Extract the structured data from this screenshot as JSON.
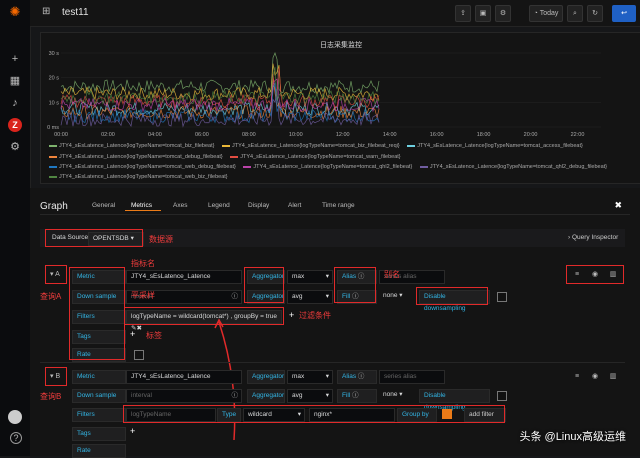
{
  "dashboard": {
    "title": "test11"
  },
  "topbar": {
    "today_label": "Today"
  },
  "graph": {
    "title": "日志采集监控",
    "y_ticks": [
      "30 s",
      "20 s",
      "10 s",
      "0 ms"
    ],
    "x_ticks": [
      "00:00",
      "02:00",
      "04:00",
      "06:00",
      "08:00",
      "10:00",
      "12:00",
      "14:00",
      "16:00",
      "18:00",
      "20:00",
      "22:00"
    ],
    "legend": [
      "JTY4_sEsLatence_Latence{logTypeName=tomcat_biz_filebeat}",
      "JTY4_sEsLatence_Latence{logTypeName=tomcat_biz_filebeat_reqi}",
      "JTY4_sEsLatence_Latence{logTypeName=tomcat_access_filebeat}",
      "JTY4_sEsLatence_Latence{logTypeName=tomcat_debug_filebeat}",
      "JTY4_sEsLatence_Latence{logTypeName=tomcat_warn_filebeat}",
      "JTY4_sEsLatence_Latence{logTypeName=tomcat_web_debug_filebeat}",
      "JTY4_sEsLatence_Latence{logTypeName=tomcat_qhl2_filebeat}",
      "JTY4_sEsLatence_Latence{logTypeName=tomcat_qhl2_debug_filebeat}",
      "JTY4_sEsLatence_Latence{logTypeName=tomcat_web_biz_filebeat}"
    ],
    "legend_colors": [
      "#7eb26d",
      "#eab839",
      "#6ed0e0",
      "#ef843c",
      "#e24d42",
      "#1f78c1",
      "#ba43a9",
      "#705da0",
      "#508642"
    ]
  },
  "editor": {
    "title": "Graph",
    "tabs": [
      "General",
      "Metrics",
      "Axes",
      "Legend",
      "Display",
      "Alert",
      "Time range"
    ],
    "datasource_label": "Data Source",
    "datasource_value": "OPENTSDB",
    "query_inspector": "Query Inspector",
    "query_a": {
      "letter": "A",
      "metric_label": "Metric",
      "metric_value": "JTY4_sEsLatence_Latence",
      "aggregator_label": "Aggregator",
      "aggregator_value": "max",
      "alias_label": "Alias",
      "alias_placeholder": "series alias",
      "downsample_label": "Down sample",
      "downsample_placeholder": "interval",
      "downsample_agg": "avg",
      "fill_label": "Fill",
      "fill_value": "none",
      "disable_ds": "Disable downsampling",
      "filters_label": "Filters",
      "filter_expr": "logTypeName = wildcard(tomcat*) , groupBy = true",
      "tags_label": "Tags",
      "rate_label": "Rate"
    },
    "query_b": {
      "letter": "B",
      "metric_label": "Metric",
      "metric_value": "JTY4_sEsLatence_Latence",
      "aggregator_label": "Aggregator",
      "aggregator_value": "max",
      "alias_label": "Alias",
      "alias_placeholder": "series alias",
      "downsample_label": "Down sample",
      "downsample_placeholder": "interval",
      "downsample_agg": "avg",
      "fill_label": "Fill",
      "fill_value": "none",
      "disable_ds": "Disable downsampling",
      "filters_label": "Filters",
      "filter_key_placeholder": "logTypeName",
      "type_label": "Type",
      "type_value": "wildcard",
      "filter_value": "nginx*",
      "groupby_label": "Group by",
      "add_filter": "add filter",
      "tags_label": "Tags",
      "rate_label": "Rate"
    }
  },
  "annotations": {
    "datasource": "数据源",
    "metric": "指标名",
    "alias": "别名",
    "downsample": "平采样",
    "filter": "过滤条件",
    "tags": "标签",
    "query_a": "查询A",
    "query_b": "查询B"
  },
  "watermark": "头条 @Linux高级运维"
}
